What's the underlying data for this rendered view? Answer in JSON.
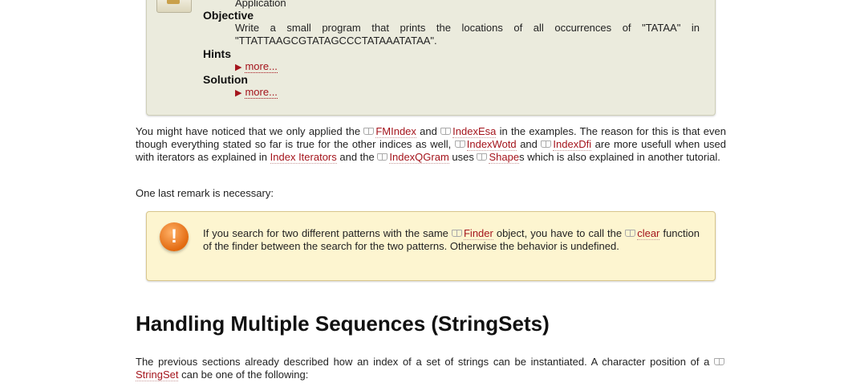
{
  "assignment": {
    "top_text": "Application",
    "objective_label": "Objective",
    "objective_text": "Write a small program that prints the locations of all occurrences of \"TATAA\" in \"TTATTAAGCGTATAGCCCTATAAATATAA\".",
    "hints_label": "Hints",
    "solution_label": "Solution",
    "more_label": "more..."
  },
  "para1": {
    "t1": "You might have noticed that we only applied the ",
    "fmindex": "FMIndex",
    "t2": " and ",
    "indexesa": "IndexEsa",
    "t3": " in the examples. The reason for this is that even though everything stated so far is true for the other indices as well, ",
    "indexwotd": "IndexWotd",
    "t4": " and ",
    "indexdfi": "IndexDfi",
    "t5": " are more usefull when used with iterators as explained in ",
    "index_iterators": "Index Iterators",
    "t6": " and the ",
    "indexqgram": "IndexQGram",
    "t7": " uses ",
    "shape": "Shape",
    "t8": "s which is also explained in another tutorial."
  },
  "para2": "One last remark is necessary:",
  "warning": {
    "icon": "!",
    "t1": "If you search for two different patterns with the same ",
    "finder": "Finder",
    "t2": " object, you have to call the ",
    "clear": "clear",
    "t3": " function of the finder between the search for the two patterns. Otherwise the behavior is undefined."
  },
  "heading": "Handling Multiple Sequences (StringSets)",
  "para3": {
    "t1": "The previous sections already described how an index of a set of strings can be instantiated. A character position of a ",
    "stringset": "StringSet",
    "t2": " can be one of the following:"
  }
}
